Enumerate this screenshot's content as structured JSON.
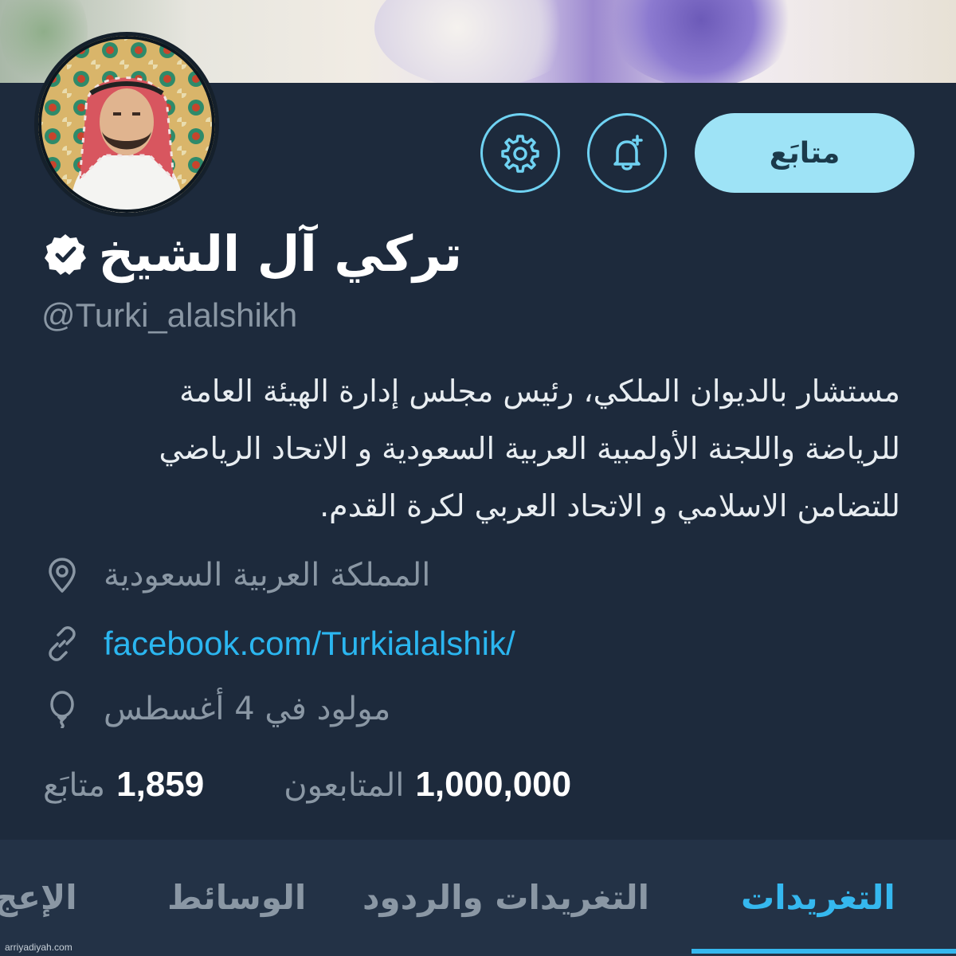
{
  "profile": {
    "display_name": "تركي آل الشيخ",
    "verified": true,
    "handle": "@Turki_alalshikh",
    "bio_lines": [
      "مستشار بالديوان الملكي، رئيس مجلس إدارة الهيئة العامة",
      "للرياضة واللجنة الأولمبية العربية السعودية و الاتحاد الرياضي",
      "للتضامن الاسلامي و الاتحاد العربي لكرة القدم."
    ],
    "location": "المملكة العربية السعودية",
    "website": "facebook.com/Turkialalshik/",
    "birthday": "مولود في 4 أغسطس"
  },
  "actions": {
    "follow_label": "متابَع"
  },
  "stats": {
    "followers_count": "1,000,000",
    "followers_label": "المتابعون",
    "following_count": "1,859",
    "following_label": "متابَع"
  },
  "tabs": [
    {
      "label": "التغريدات",
      "active": true
    },
    {
      "label": "التغريدات والردود",
      "active": false
    },
    {
      "label": "الوسائط",
      "active": false
    },
    {
      "label": "الإعج",
      "active": false
    }
  ],
  "footer": {
    "watermark": "arriyadiyah.com"
  },
  "colors": {
    "accent": "#35b8ef",
    "follow_button": "#9ee3f6",
    "background": "#1d2a3c"
  },
  "icons": {
    "settings": "gear-icon",
    "notify": "bell-plus-icon",
    "verified": "verified-badge-icon",
    "location": "location-pin-icon",
    "link": "link-icon",
    "birthday": "balloon-icon"
  }
}
